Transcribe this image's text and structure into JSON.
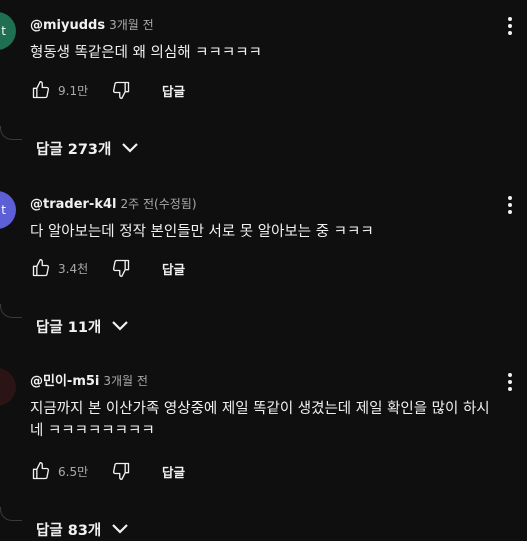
{
  "comments": [
    {
      "avatar_letter": "t",
      "avatar_color": "#1f6f52",
      "author": "@miyudds",
      "time": "3개월 전",
      "text": "형동생 똑같은데 왜 의심해 ㅋㅋㅋㅋㅋ",
      "likes": "9.1만",
      "reply_label": "답글",
      "replies_toggle": "답글 273개"
    },
    {
      "avatar_letter": "t",
      "avatar_color": "#5c5fd6",
      "author": "@trader-k4l",
      "time": "2주 전(수정됨)",
      "text": "다 알아보는데 정작 본인들만 서로 못 알아보는 중 ㅋㅋㅋ",
      "likes": "3.4천",
      "reply_label": "답글",
      "replies_toggle": "답글 11개"
    },
    {
      "avatar_letter": "",
      "avatar_color": "#2a1414",
      "author": "@민이-m5i",
      "time": "3개월 전",
      "text": "지금까지 본 이산가족 영상중에 제일 똑같이 생겼는데 제일 확인을 많이 하시네 ㅋㅋㅋㅋㅋㅋㅋㅋ",
      "likes": "6.5만",
      "reply_label": "답글",
      "replies_toggle": "답글 83개"
    }
  ],
  "icons": {
    "like": "thumb-up-icon",
    "dislike": "thumb-down-icon",
    "menu": "more-vert-icon",
    "expand": "chevron-down-icon"
  },
  "colors": {
    "background": "#0f0f0f",
    "primary_text": "#f1f1f1",
    "secondary_text": "#aaaaaa"
  }
}
